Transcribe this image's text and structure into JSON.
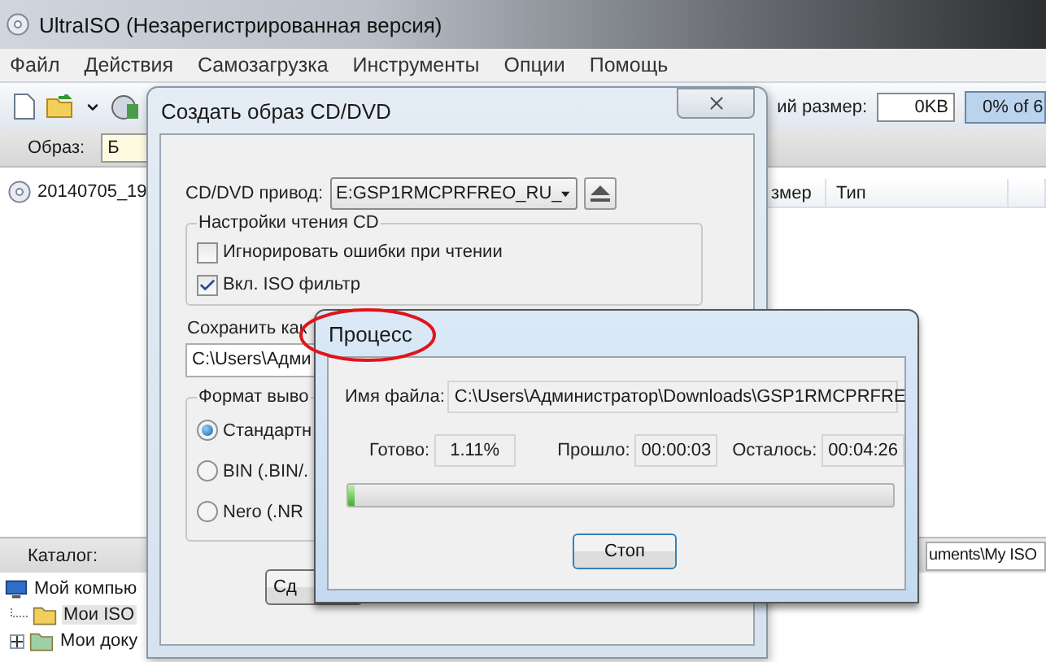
{
  "window": {
    "title": "UltraISO (Незарегистрированная версия)"
  },
  "menu": [
    "Файл",
    "Действия",
    "Самозагрузка",
    "Инструменты",
    "Опции",
    "Помощь"
  ],
  "toolbar": {
    "size_label": "ий размер:",
    "size_value": "0KB",
    "capacity": "0% of 6"
  },
  "image_bar": {
    "label": "Образ:",
    "value": "Б"
  },
  "file_list": {
    "items": [
      "20140705_19"
    ]
  },
  "file_table": {
    "columns": [
      "змер",
      "Тип"
    ]
  },
  "catalog_bar": {
    "label": "Каталог:",
    "path": "uments\\My ISO"
  },
  "tree": {
    "items": [
      {
        "label": "Мой компью",
        "children": [
          {
            "label": "Мои ISO",
            "selected": true,
            "expandable": false
          },
          {
            "label": "Мои доку",
            "selected": false,
            "expandable": true
          }
        ]
      }
    ]
  },
  "create_dialog": {
    "title": "Создать образ CD/DVD",
    "drive_label": "CD/DVD привод:",
    "drive_value": "E:GSP1RMCPRFREO_RU_",
    "read_group": {
      "title": "Настройки чтения CD",
      "options": [
        {
          "label": "Игнорировать ошибки при чтении",
          "checked": false
        },
        {
          "label": "Вкл. ISO фильтр",
          "checked": true
        }
      ]
    },
    "save_label": "Сохранить как",
    "save_value": "C:\\Users\\Адми",
    "format_group": {
      "title": "Формат выво",
      "options": [
        {
          "label": "Стандартн",
          "selected": true
        },
        {
          "label": "BIN (.BIN/.",
          "selected": false
        },
        {
          "label": "Nero (.NR",
          "selected": false
        }
      ]
    },
    "button": "Сд"
  },
  "process_dialog": {
    "title": "Процесс",
    "highlighted": true,
    "file_label": "Имя файла:",
    "file_value": "C:\\Users\\Администратор\\Downloads\\GSP1RMCPRFRE",
    "done_label": "Готово:",
    "done_value": "1.11%",
    "elapsed_label": "Прошло:",
    "elapsed_value": "00:00:03",
    "remaining_label": "Осталось:",
    "remaining_value": "00:04:26",
    "progress": {
      "level": 0.011
    },
    "button": "Стоп"
  }
}
